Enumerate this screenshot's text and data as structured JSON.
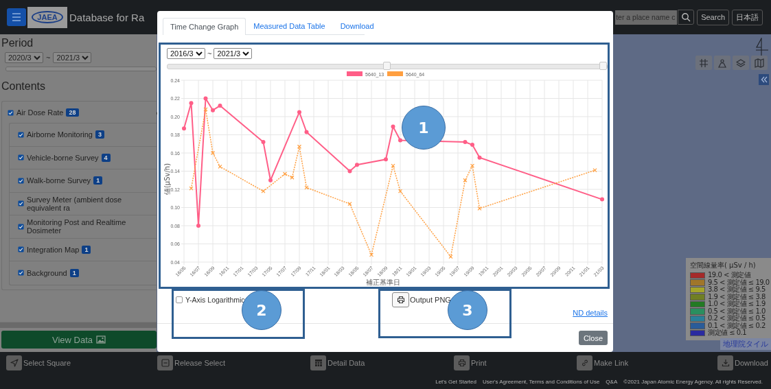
{
  "header": {
    "logo_text": "JAEA",
    "title": "Database for Ra",
    "search": {
      "value": "ter a place name c"
    },
    "search_button": "Search",
    "language_button": "日本語"
  },
  "sidebar": {
    "period_title": "Period",
    "period_from": "2020/3",
    "period_separator": "~",
    "period_to": "2021/3",
    "period_slider": {
      "level": 1
    },
    "contents_title": "Contents",
    "layers": [
      {
        "label": "Air Dose Rate",
        "count": "28",
        "checked": true,
        "children": [
          {
            "label": "Airborne Monitoring",
            "count": "3",
            "checked": true
          },
          {
            "label": "Vehicle-borne Survey",
            "count": "4",
            "checked": true
          },
          {
            "label": "Walk-borne Survey",
            "count": "1",
            "checked": true
          },
          {
            "label": "Survey Meter (ambient dose equivalent ra",
            "checked": true
          },
          {
            "label": "Monitoring Post and Realtime Dosimeter",
            "checked": true
          },
          {
            "label": "Integration Map",
            "count": "1",
            "checked": true
          },
          {
            "label": "Background",
            "count": "1",
            "checked": true
          }
        ]
      }
    ],
    "view_button": "View Data"
  },
  "map": {
    "legend": {
      "title": "空間線量率( μSv / h)",
      "rows": [
        {
          "label": "19.0 < 測定値",
          "color": "#a52a2a"
        },
        {
          "label": "9.5 < 測定値 ≤ 19.0",
          "color": "#a0762a"
        },
        {
          "label": "3.8 < 測定値 ≤ 9.5",
          "color": "#a5a52a"
        },
        {
          "label": "1.9 < 測定値 ≤ 3.8",
          "color": "#707f24"
        },
        {
          "label": "1.0 < 測定値 ≤ 1.9",
          "color": "#237a23"
        },
        {
          "label": "0.5 < 測定値 ≤ 1.0",
          "color": "#2a8f5f"
        },
        {
          "label": "0.2 < 測定値 ≤ 0.5",
          "color": "#2a7f99"
        },
        {
          "label": "0.1 < 測定値 ≤ 0.2",
          "color": "#2a5c99"
        },
        {
          "label": "測定値 ≤ 0.1",
          "color": "#2a2aa0"
        }
      ]
    },
    "tile_link": "地理院タイル"
  },
  "toolbar": [
    {
      "kind": "select",
      "label": "Select Square"
    },
    {
      "kind": "release",
      "label": "Release Select"
    },
    {
      "kind": "detail",
      "label": "Detail Data"
    },
    {
      "kind": "print",
      "label": "Print"
    },
    {
      "kind": "link",
      "label": "Make Link"
    },
    {
      "kind": "download",
      "label": "Download"
    }
  ],
  "footer": {
    "links": [
      "Let's Get Started",
      "User's Agreement, Terms and Conditions of Use",
      "Q&A"
    ],
    "copyright": "©2021 Japan Atomic Energy Agency. All rights Reserved."
  },
  "modal": {
    "tabs": [
      {
        "label": "Time Change Graph",
        "selected": true
      },
      {
        "label": "Measured Data Table",
        "selected": false
      },
      {
        "label": "Download",
        "selected": false
      }
    ],
    "range": {
      "from": "2016/3",
      "separator": "~",
      "to": "2021/3",
      "handles": [
        {
          "level": 0.5
        },
        {
          "level": 1
        }
      ]
    },
    "chart_data": {
      "type": "line",
      "grid": true,
      "legend": "top",
      "xlabel": "補正基準日",
      "ylabel": "値(μSv/h)",
      "categories": [
        "16/05",
        null,
        "16/07",
        null,
        "16/09",
        null,
        "16/11",
        null,
        "17/01",
        null,
        "17/03",
        null,
        "17/05",
        null,
        "17/07",
        null,
        "17/09",
        null,
        "17/11",
        null,
        "18/01",
        null,
        "18/03",
        null,
        "18/05",
        null,
        "18/07",
        null,
        "18/09",
        null,
        "18/11",
        null,
        "19/01",
        null,
        "19/03",
        null,
        "19/05",
        null,
        "19/07",
        null,
        "19/09",
        null,
        "19/11",
        null,
        "20/01",
        null,
        "20/03",
        null,
        "20/05",
        null,
        "20/07",
        null,
        "20/09",
        null,
        "20/11",
        null,
        "21/01",
        null,
        "21/03"
      ],
      "series": [
        {
          "name": "5640_13",
          "color": "#ff5e87",
          "marker": "circle",
          "line_style": "solid",
          "values": [
            0.187,
            0.215,
            0.08,
            0.22,
            0.207,
            0.212,
            null,
            null,
            null,
            null,
            null,
            0.172,
            0.13,
            null,
            null,
            null,
            0.205,
            0.183,
            null,
            null,
            null,
            null,
            null,
            0.14,
            0.147,
            null,
            null,
            null,
            0.153,
            0.189,
            0.174,
            null,
            null,
            null,
            null,
            null,
            null,
            null,
            null,
            0.172,
            0.169,
            0.155,
            null,
            null,
            null,
            null,
            null,
            null,
            null,
            null,
            null,
            null,
            null,
            null,
            null,
            null,
            null,
            null,
            0.109
          ]
        },
        {
          "name": "5640_64",
          "color": "#ff9f40",
          "marker": "cross",
          "line_style": "dashed",
          "values": [
            null,
            0.121,
            null,
            0.208,
            0.16,
            0.145,
            null,
            null,
            null,
            null,
            null,
            0.118,
            null,
            null,
            0.137,
            0.133,
            0.167,
            0.122,
            null,
            null,
            null,
            null,
            null,
            0.104,
            null,
            null,
            0.048,
            null,
            null,
            0.146,
            0.118,
            null,
            null,
            null,
            null,
            null,
            null,
            0.046,
            null,
            0.13,
            0.146,
            0.099,
            null,
            null,
            null,
            null,
            null,
            null,
            null,
            null,
            null,
            null,
            null,
            null,
            null,
            null,
            null,
            0.141,
            null
          ]
        }
      ],
      "ylim": [
        0.04,
        0.24
      ],
      "yticks": [
        {
          "value": 0.04,
          "label": "0.04"
        },
        {
          "value": 0.06,
          "label": "0.06"
        },
        {
          "value": 0.08,
          "label": "0.08"
        },
        {
          "value": 0.1,
          "label": "0.10"
        },
        {
          "value": 0.12,
          "label": "0.12"
        },
        {
          "value": 0.14,
          "label": "0.14"
        },
        {
          "value": 0.16,
          "label": "0.16"
        },
        {
          "value": 0.18,
          "label": "0.18"
        },
        {
          "value": 0.2,
          "label": "0.20"
        },
        {
          "value": 0.22,
          "label": "0.22"
        },
        {
          "value": 0.24,
          "label": "0.24"
        }
      ]
    },
    "log_axis": {
      "label": "Y-Axis Logarithmic",
      "checked": false
    },
    "export_button": "Output PNG",
    "nd_link": "ND details",
    "close_button": "Close"
  },
  "callouts": [
    {
      "label": "1"
    },
    {
      "label": "2"
    },
    {
      "label": "3"
    }
  ]
}
